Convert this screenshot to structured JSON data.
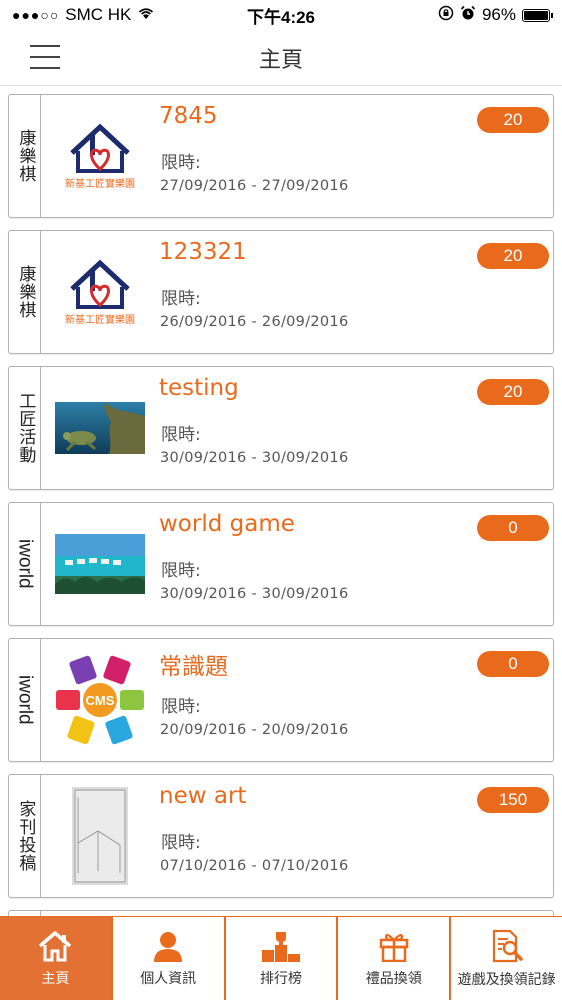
{
  "status_bar": {
    "carrier": "SMC HK",
    "time": "下午4:26",
    "battery": "96%"
  },
  "header": {
    "title": "主頁"
  },
  "cards": [
    {
      "category": "康樂棋",
      "title": "7845",
      "limit_label": "限時:",
      "dates": "27/09/2016 - 27/09/2016",
      "points": "20",
      "thumb": "logo",
      "logo_caption": "新基工匠實樂園"
    },
    {
      "category": "康樂棋",
      "title": "123321",
      "limit_label": "限時:",
      "dates": "26/09/2016 - 26/09/2016",
      "points": "20",
      "thumb": "logo",
      "logo_caption": "新基工匠實樂園"
    },
    {
      "category": "工匠活動",
      "title": "testing",
      "limit_label": "限時:",
      "dates": "30/09/2016 - 30/09/2016",
      "points": "20",
      "thumb": "sea-turtle"
    },
    {
      "category": "iworld",
      "title": "world game",
      "limit_label": "限時:",
      "dates": "30/09/2016 - 30/09/2016",
      "points": "0",
      "thumb": "beach-villas"
    },
    {
      "category": "iworld",
      "title": "常識題",
      "limit_label": "限時:",
      "dates": "20/09/2016 - 20/09/2016",
      "points": "0",
      "thumb": "cms-diagram",
      "cms_label": "CMS"
    },
    {
      "category": "家刊投稿",
      "title": "new art",
      "limit_label": "限時:",
      "dates": "07/10/2016 - 07/10/2016",
      "points": "150",
      "thumb": "sketch-photo"
    }
  ],
  "tabbar": {
    "items": [
      {
        "label": "主頁",
        "icon": "home-icon",
        "active": true
      },
      {
        "label": "個人資訊",
        "icon": "person-icon",
        "active": false
      },
      {
        "label": "排行榜",
        "icon": "trophy-podium-icon",
        "active": false
      },
      {
        "label": "禮品換領",
        "icon": "gift-icon",
        "active": false
      },
      {
        "label": "遊戲及換領記錄",
        "icon": "record-search-icon",
        "active": false
      }
    ]
  },
  "colors": {
    "accent": "#ea6a1d",
    "tab_active_bg": "#e27133"
  }
}
